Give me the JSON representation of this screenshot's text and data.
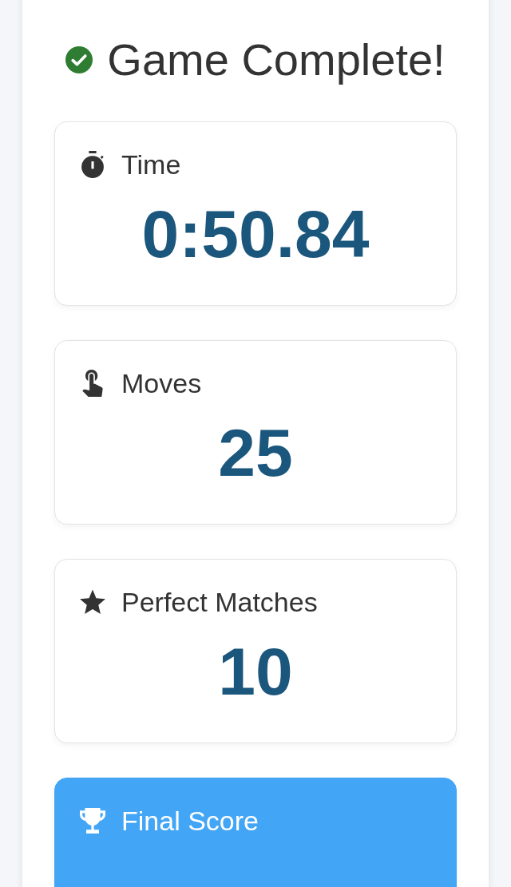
{
  "title": {
    "text": "Game Complete!"
  },
  "stats": [
    {
      "kind": "time",
      "label": "Time",
      "value": "0:50.84",
      "highlighted": false
    },
    {
      "kind": "moves",
      "label": "Moves",
      "value": "25",
      "highlighted": false
    },
    {
      "kind": "perfect",
      "label": "Perfect Matches",
      "value": "10",
      "highlighted": false
    },
    {
      "kind": "score",
      "label": "Final Score",
      "highlighted": true
    }
  ]
}
